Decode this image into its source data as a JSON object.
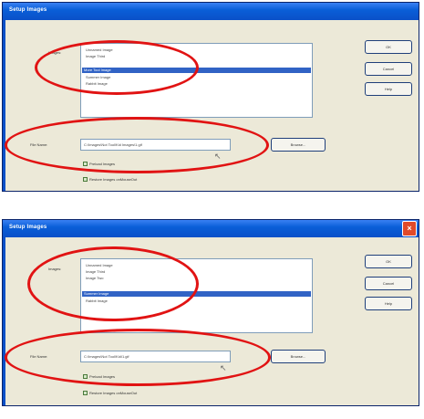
{
  "dialogs": [
    {
      "title": "Setup Images",
      "close_glyph": "×",
      "images_label": "Images:",
      "list_items": [
        "Unnamed Image",
        "Image Third",
        "More Tool Image",
        "Summer Image",
        "Rabbit Image"
      ],
      "selected_index": 2,
      "file_label": "File Name:",
      "file_value": "C:\\Images\\Not Tool\\Kid Images\\1.gif",
      "browse_label": "Browse...",
      "ok_label": "OK",
      "cancel_label": "Cancel",
      "help_label": "Help",
      "checkbox_1": "Preload Images",
      "checkbox_2": "Restore Images onMouseOut"
    },
    {
      "title": "Setup Images",
      "close_glyph": "×",
      "images_label": "Images:",
      "list_items": [
        "Unnamed Image",
        "Image Third",
        "Image Two",
        "Summer Image",
        "Rabbit Image"
      ],
      "selected_index": 3,
      "file_label": "File Name:",
      "file_value": "C:\\Images\\Not Tool\\Kid\\1.gif",
      "browse_label": "Browse...",
      "ok_label": "OK",
      "cancel_label": "Cancel",
      "help_label": "Help",
      "checkbox_1": "Preload Images",
      "checkbox_2": "Restore Images onMouseOut"
    }
  ],
  "colors": {
    "titlebar": "#0a5fd8",
    "selection": "#3163c5",
    "annotation_ellipse": "#e11313",
    "dialog_bg": "#ece9d8"
  }
}
